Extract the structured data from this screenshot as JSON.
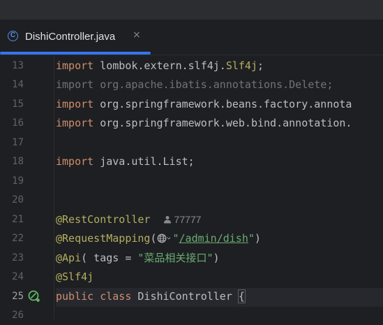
{
  "tab": {
    "title": "DishiController.java",
    "icon_letter": "C",
    "close_glyph": "×"
  },
  "gutter": {
    "line_numbers": [
      "13",
      "14",
      "15",
      "16",
      "17",
      "18",
      "19",
      "20",
      "21",
      "22",
      "23",
      "24",
      "25",
      "26"
    ],
    "current_line": "25"
  },
  "code": {
    "l13": {
      "kw": "import",
      "rest": " lombok.extern.slf4j.",
      "cls": "Slf4j",
      "end": ";"
    },
    "l14": {
      "text": "import org.apache.ibatis.annotations.Delete;"
    },
    "l15": {
      "kw": "import",
      "rest": " org.springframework.beans.factory.annota"
    },
    "l16": {
      "kw": "import",
      "rest": " org.springframework.web.bind.annotation."
    },
    "l18": {
      "kw": "import",
      "rest": " java.util.List;"
    },
    "l21": {
      "ann": "@RestController",
      "author": "77777"
    },
    "l22": {
      "ann": "@RequestMapping",
      "open": "(",
      "q1": "\"",
      "path": "/admin/dish",
      "q2": "\"",
      "close": ")"
    },
    "l23": {
      "ann": "@Api",
      "rest": "( tags = ",
      "str": "\"菜品相关接口\"",
      "close": ")"
    },
    "l24": {
      "ann": "@Slf4j"
    },
    "l25": {
      "kw1": "public",
      "kw2": "class",
      "name": " DishiController ",
      "brace": "{"
    }
  },
  "colors": {
    "keyword": "#cf8e6d",
    "annotation": "#b3ae60",
    "string": "#6aab73",
    "accent": "#3574f0"
  }
}
